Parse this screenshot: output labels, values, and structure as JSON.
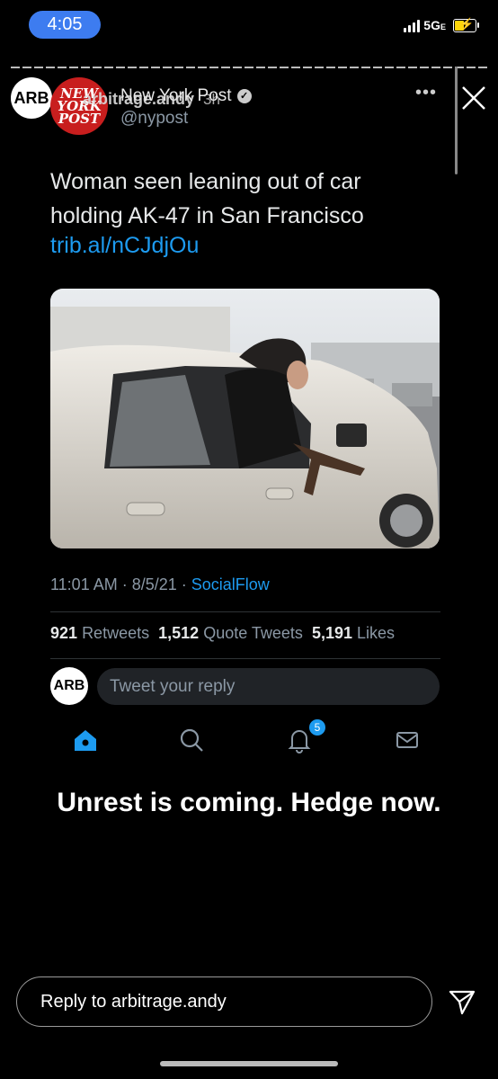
{
  "status_bar": {
    "time": "4:05",
    "network": "5G",
    "network_suffix": "E"
  },
  "story": {
    "avatar_text": "ARB",
    "username": "arbitrage.andy",
    "time_ago": "3h",
    "reply_placeholder": "Reply to arbitrage.andy",
    "caption": "Unrest is coming. Hedge now."
  },
  "tweet": {
    "avatar_lines": [
      "NEW",
      "YORK",
      "POST"
    ],
    "display_name": "New York Post",
    "handle": "@nypost",
    "text": "Woman seen leaning out of car holding AK-47 in San Francisco",
    "link": "trib.al/nCJdjOu",
    "timestamp": "11:01 AM · 8/5/21 · ",
    "source": "SocialFlow",
    "retweets_count": "921",
    "retweets_label": "Retweets",
    "quotes_count": "1,512",
    "quotes_label": "Quote Tweets",
    "likes_count": "5,191",
    "likes_label": "Likes",
    "reply_avatar_text": "ARB",
    "reply_placeholder": "Tweet your reply",
    "notifications_badge": "5"
  },
  "colors": {
    "accent": "#1d9bf0",
    "time_pill": "#3d7cf0",
    "nyp_red": "#c81e1e"
  }
}
